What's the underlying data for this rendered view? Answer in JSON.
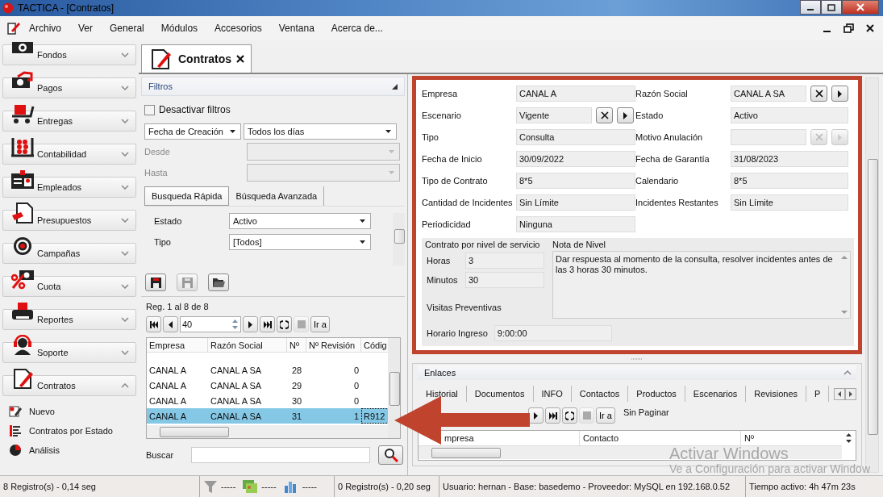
{
  "window": {
    "title": "TACTICA - [Contratos]"
  },
  "menu": [
    "Archivo",
    "Ver",
    "General",
    "Módulos",
    "Accesorios",
    "Ventana",
    "Acerca de..."
  ],
  "sidebar": {
    "items": [
      {
        "label": "Fondos",
        "expanded": false
      },
      {
        "label": "Pagos",
        "expanded": false
      },
      {
        "label": "Entregas",
        "expanded": false
      },
      {
        "label": "Contabilidad",
        "expanded": false
      },
      {
        "label": "Empleados",
        "expanded": false
      },
      {
        "label": "Presupuestos",
        "expanded": false
      },
      {
        "label": "Campañas",
        "expanded": false
      },
      {
        "label": "Cuota",
        "expanded": false
      },
      {
        "label": "Reportes",
        "expanded": false
      },
      {
        "label": "Soporte",
        "expanded": false
      },
      {
        "label": "Contratos",
        "expanded": true,
        "children": [
          {
            "label": "Nuevo"
          },
          {
            "label": "Contratos por Estado"
          },
          {
            "label": "Análisis"
          }
        ]
      }
    ]
  },
  "document_tabs": [
    {
      "label": "Contratos",
      "selected": true
    }
  ],
  "filters": {
    "title": "Filtros",
    "disable_filters": {
      "label": "Desactivar filtros",
      "checked": false
    },
    "date_field": "Fecha de Creación",
    "date_range": "Todos los días",
    "range": [
      {
        "label": "Desde",
        "disabled": true
      },
      {
        "label": "Hasta",
        "disabled": true
      }
    ],
    "tabs": [
      {
        "label": "Busqueda Rápida",
        "selected": true
      },
      {
        "label": "Búsqueda Avanzada",
        "selected": false
      }
    ],
    "fields": [
      {
        "label": "Estado",
        "value": "Activo"
      },
      {
        "label": "Tipo",
        "value": "[Todos]"
      }
    ],
    "toolbar": [
      {
        "kind": "save",
        "disabled": false
      },
      {
        "kind": "save",
        "disabled": true
      },
      {
        "kind": "open",
        "disabled": false
      }
    ]
  },
  "results": {
    "record_info": "Reg. 1 al 8 de 8",
    "pager": {
      "shown": "40",
      "go_label": "Ir a",
      "stop_disabled": true
    },
    "columns": [
      "Empresa",
      "Razón Social",
      "Nº",
      "Nº Revisión",
      "Códig"
    ],
    "rows": [
      {
        "cells": [
          "CANAL A",
          "CANAL A SA",
          "28",
          "0"
        ],
        "selected": false
      },
      {
        "cells": [
          "CANAL A",
          "CANAL A SA",
          "29",
          "0"
        ],
        "selected": false
      },
      {
        "cells": [
          "CANAL A",
          "CANAL A SA",
          "30",
          "0"
        ],
        "selected": false
      },
      {
        "cells": [
          "CANAL A",
          "CANAL A SA",
          "31",
          "1",
          "R912"
        ],
        "selected": true
      }
    ],
    "search_label": "Buscar"
  },
  "contract": {
    "fields": [
      {
        "label": "Empresa",
        "value": "CANAL A",
        "kind": "text"
      },
      {
        "label": "Razón Social",
        "value": "CANAL A SA",
        "kind": "lookup",
        "disabled": false
      },
      {
        "label": "Escenario",
        "value": "Vigente",
        "kind": "lookup",
        "disabled": false
      },
      {
        "label": "Estado",
        "value": "Activo",
        "kind": "text"
      },
      {
        "label": "Tipo",
        "value": "Consulta",
        "kind": "text"
      },
      {
        "label": "Motivo Anulación",
        "kind": "lookup",
        "disabled": true
      },
      {
        "label": "Fecha de Inicio",
        "value": "30/09/2022",
        "kind": "text"
      },
      {
        "label": "Fecha de Garantía",
        "value": "31/08/2023",
        "kind": "text"
      },
      {
        "label": "Tipo de Contrato",
        "value": "8*5",
        "kind": "text"
      },
      {
        "label": "Calendario",
        "value": "8*5",
        "kind": "text"
      },
      {
        "label": "Cantidad de Incidentes",
        "value": "Sin Límite",
        "kind": "text"
      },
      {
        "label": "Incidentes Restantes",
        "value": "Sin Límite",
        "kind": "text"
      },
      {
        "label": "Periodicidad",
        "value": "Ninguna",
        "kind": "text"
      }
    ],
    "service_level": {
      "title": "Contrato por nivel de servicio",
      "hours": {
        "label": "Horas",
        "value": "3"
      },
      "minutes": {
        "label": "Minutos",
        "value": "30"
      },
      "preventive_visits": "Visitas Preventivas",
      "entry_time": {
        "label": "Horario Ingreso",
        "value": "9:00:00"
      },
      "note": {
        "title": "Nota de Nivel",
        "text": "Dar respuesta al momento de la consulta, resolver incidentes antes de las 3 horas 30 minutos."
      }
    }
  },
  "links": {
    "title": "Enlaces",
    "tabs": [
      {
        "label": "Historial",
        "selected": false
      },
      {
        "label": "Documentos",
        "selected": false
      },
      {
        "label": "INFO",
        "selected": false
      },
      {
        "label": "Contactos",
        "selected": false
      },
      {
        "label": "Productos",
        "selected": false
      },
      {
        "label": "Escenarios",
        "selected": false
      },
      {
        "label": "Revisiones",
        "selected": false
      },
      {
        "label": "P",
        "selected": false
      }
    ],
    "pager": {
      "go_label": "Ir a",
      "mode": "Sin Paginar"
    },
    "columns": [
      "mpresa",
      "Contacto",
      "Nº"
    ]
  },
  "status_bar": {
    "left": "8 Registro(s) - 0,14 seg",
    "indicators": [
      "-----",
      "-----",
      "-----"
    ],
    "records": "0 Registro(s) - 0,20 seg",
    "connection": "Usuario: hernan - Base: basedemo - Proveedor: MySQL en 192.168.0.52",
    "uptime": "Tiempo activo: 4h 47m 23s"
  },
  "os_notice": [
    "Activar Windows",
    "Ve a Configuración para activar Window"
  ]
}
